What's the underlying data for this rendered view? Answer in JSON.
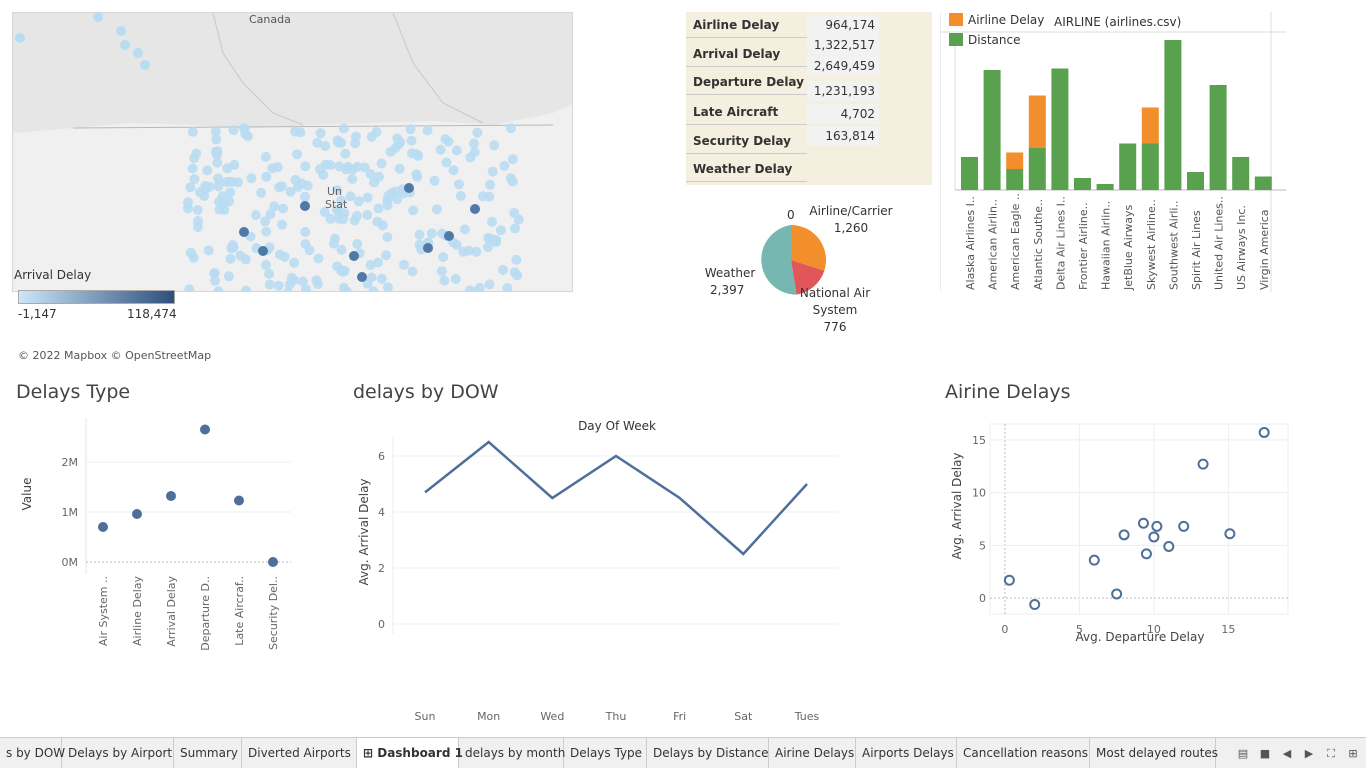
{
  "map": {
    "country_label": "Canada",
    "us_label_1": "Un",
    "us_label_2": "Stat",
    "legend_title": "Arrival Delay",
    "legend_min": "-1,147",
    "legend_max": "118,474",
    "attribution": "© 2022 Mapbox © OpenStreetMap"
  },
  "delay_table": {
    "rows": [
      {
        "name": "Airline Delay",
        "value": "964,174"
      },
      {
        "name": "Arrival Delay",
        "value": "1,322,517"
      },
      {
        "name": "Departure Delay",
        "value": "2,649,459"
      },
      {
        "name": "",
        "value": "1,231,193"
      },
      {
        "name": "Late Aircraft Delay",
        "value": "4,702"
      },
      {
        "name": "Security Delay",
        "value": "163,814"
      },
      {
        "name": "Weather Delay",
        "value": ""
      }
    ]
  },
  "pie": {
    "zero_label": "0",
    "airline_label": "Airline/Carrier",
    "airline_value": "1,260",
    "weather_label": "Weather",
    "weather_value": "2,397",
    "nas_label": "National Air System",
    "nas_value": "776",
    "colors": {
      "airline": "#f28e2b",
      "weather": "#76b7b2",
      "nas": "#e15759"
    }
  },
  "airline_chart": {
    "title": "AIRLINE (airlines.csv)",
    "legend": [
      {
        "name": "Airline Delay",
        "color": "#f28e2b"
      },
      {
        "name": "Distance",
        "color": "#59a14f"
      }
    ]
  },
  "delays_type": {
    "title": "Delays Type"
  },
  "dow": {
    "title": "delays by DOW"
  },
  "airine_delays": {
    "title": "Airine Delays"
  },
  "chart_data": [
    {
      "type": "bar",
      "title": "AIRLINE (airlines.csv)",
      "categories": [
        "Alaska Airlines I..",
        "American Airlin..",
        "American Eagle ..",
        "Atlantic Southe..",
        "Delta Air Lines I..",
        "Frontier Airline..",
        "Hawaiian Airlin..",
        "JetBlue Airways",
        "Skywest Airline..",
        "Southwest Airli..",
        "Spirit Air Lines",
        "United Air Lines..",
        "US Airways Inc.",
        "Virgin America"
      ],
      "series": [
        {
          "name": "Distance",
          "values": [
            0.22,
            0.8,
            0.14,
            0.28,
            0.81,
            0.08,
            0.04,
            0.31,
            0.31,
            1.0,
            0.12,
            0.7,
            0.22,
            0.09
          ]
        },
        {
          "name": "Airline Delay",
          "values": [
            0,
            0,
            0.11,
            0.35,
            0,
            0,
            0,
            0,
            0.24,
            0,
            0,
            0,
            0,
            0
          ]
        }
      ],
      "stacked": true
    },
    {
      "type": "scatter",
      "title": "Delays Type",
      "categories": [
        "Air System ..",
        "Airline Delay",
        "Arrival Delay",
        "Departure D..",
        "Late Aircraf..",
        "Security Del.."
      ],
      "values": [
        700000,
        960000,
        1320000,
        2650000,
        1230000,
        0
      ],
      "ylabel": "Value",
      "yticks": [
        "0M",
        "1M",
        "2M"
      ],
      "ylim": [
        0,
        2700000
      ]
    },
    {
      "type": "line",
      "title": "Day Of Week",
      "categories": [
        "Sun",
        "Mon",
        "Wed",
        "Thu",
        "Fri",
        "Sat",
        "Tues"
      ],
      "values": [
        4.7,
        6.5,
        4.5,
        6.0,
        4.5,
        2.5,
        5.0
      ],
      "ylabel": "Avg. Arrival Delay",
      "yticks": [
        "0",
        "2",
        "4",
        "6"
      ],
      "ylim": [
        0,
        7
      ]
    },
    {
      "type": "scatter",
      "title": "",
      "points": [
        [
          0.3,
          1.7
        ],
        [
          2,
          -0.6
        ],
        [
          6,
          3.6
        ],
        [
          7.5,
          0.4
        ],
        [
          8,
          6
        ],
        [
          9.3,
          7.1
        ],
        [
          9.5,
          4.2
        ],
        [
          10,
          5.8
        ],
        [
          10.2,
          6.8
        ],
        [
          11,
          4.9
        ],
        [
          12,
          6.8
        ],
        [
          13.3,
          12.7
        ],
        [
          15.1,
          6.1
        ],
        [
          17.4,
          15.7
        ]
      ],
      "xlabel": "Avg. Departure Delay",
      "ylabel": "Avg. Arrival Delay",
      "xticks": [
        "0",
        "5",
        "10",
        "15"
      ],
      "yticks": [
        "0",
        "5",
        "10",
        "15"
      ],
      "xlim": [
        -1,
        19
      ],
      "ylim": [
        -1.5,
        16.5
      ]
    }
  ],
  "tabs": [
    "s by DOW",
    "Delays by Airport",
    "Summary",
    "Diverted Airports",
    "Dashboard 1",
    "delays by month",
    "Delays Type",
    "Delays by Distance",
    "Airine Delays",
    "Airports Delays",
    "Cancellation reasons",
    "Most delayed routes"
  ],
  "active_tab": "Dashboard 1"
}
